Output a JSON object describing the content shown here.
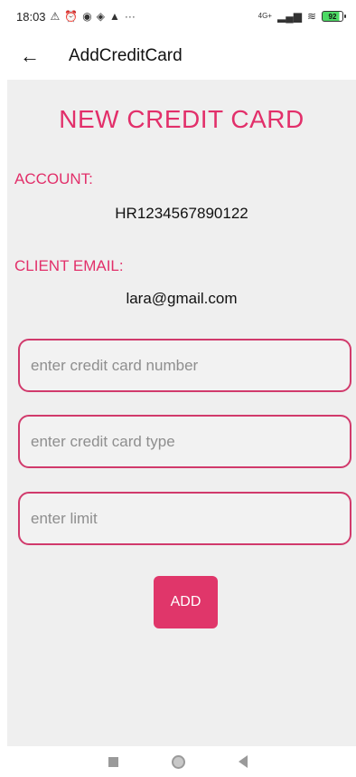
{
  "status_bar": {
    "time": "18:03",
    "icons": [
      "signal-crossed-icon",
      "alarm-icon",
      "sync-icon",
      "navigation-icon",
      "person-icon",
      "more-icon"
    ],
    "more": "···",
    "network": "4G+",
    "battery": "92"
  },
  "app_bar": {
    "back_glyph": "←",
    "title": "AddCreditCard"
  },
  "form": {
    "heading": "NEW CREDIT CARD",
    "account_label": "ACCOUNT:",
    "account_value": "HR1234567890122",
    "email_label": "CLIENT EMAIL:",
    "email_value": "lara@gmail.com",
    "card_number_placeholder": "enter credit card number",
    "card_type_placeholder": "enter credit card type",
    "limit_placeholder": "enter limit",
    "add_label": "ADD"
  },
  "colors": {
    "accent": "#e22f6a",
    "button": "#e0366a",
    "field_border": "#d13a6c",
    "panel_bg": "#efefef"
  }
}
